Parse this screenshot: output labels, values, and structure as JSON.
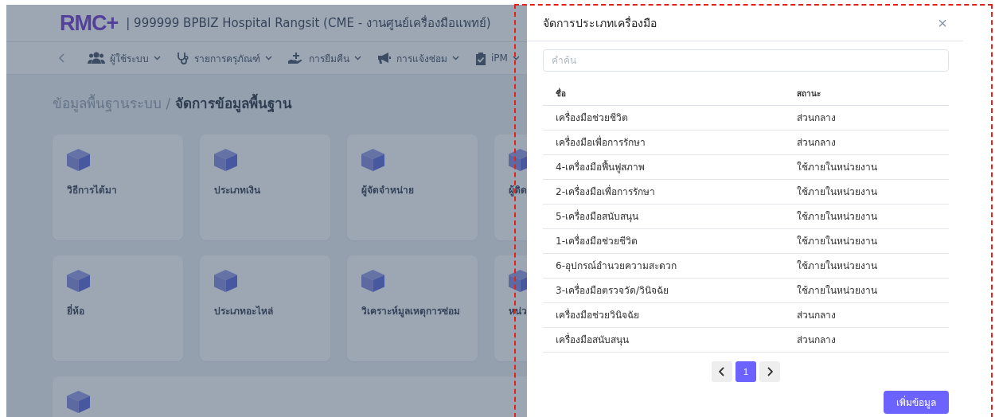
{
  "header": {
    "logo": "RMC+",
    "title": "| 999999 BPBIZ Hospital Rangsit (CME - งานศูนย์เครื่องมือแพทย์)"
  },
  "nav": [
    {
      "label": "ผู้ใช้ระบบ"
    },
    {
      "label": "รายการครุภัณฑ์"
    },
    {
      "label": "การยืมคืน"
    },
    {
      "label": "การแจ้งซ่อม"
    },
    {
      "label": "iPM"
    }
  ],
  "breadcrumb": {
    "parent": "ข้อมูลพื้นฐานระบบ /",
    "current": "จัดการข้อมูลพื้นฐาน"
  },
  "cards": [
    {
      "label": "วิธีการได้มา"
    },
    {
      "label": "ประเภทเงิน"
    },
    {
      "label": "ผู้จัดจำหน่าย"
    },
    {
      "label": "ผู้ติด"
    },
    {
      "label": "ยี่ห้อ"
    },
    {
      "label": "ประเภทอะไหล่"
    },
    {
      "label": "วิเคราะห์มูลเหตุการซ่อม"
    },
    {
      "label": "หน่ว"
    }
  ],
  "modal": {
    "title": "จัดการประเภทเครื่องมือ",
    "close": "×",
    "search": {
      "placeholder": "คำค้น"
    },
    "table": {
      "columns": [
        "ชื่อ",
        "สถานะ"
      ],
      "rows": [
        [
          "เครื่องมือช่วยชีวิต",
          "ส่วนกลาง"
        ],
        [
          "เครื่องมือเพื่อการรักษา",
          "ส่วนกลาง"
        ],
        [
          "4-เครื่องมือฟื้นฟูสภาพ",
          "ใช้ภายในหน่วยงาน"
        ],
        [
          "2-เครื่องมือเพื่อการรักษา",
          "ใช้ภายในหน่วยงาน"
        ],
        [
          "5-เครื่องมือสนับสนุน",
          "ใช้ภายในหน่วยงาน"
        ],
        [
          "1-เครื่องมือช่วยชีวิต",
          "ใช้ภายในหน่วยงาน"
        ],
        [
          "6-อุปกรณ์อำนวยความสะดวก",
          "ใช้ภายในหน่วยงาน"
        ],
        [
          "3-เครื่องมือตรวจวัด/วินิจฉัย",
          "ใช้ภายในหน่วยงาน"
        ],
        [
          "เครื่องมือช่วยวินิจฉัย",
          "ส่วนกลาง"
        ],
        [
          "เครื่องมือสนับสนุน",
          "ส่วนกลาง"
        ]
      ]
    },
    "pagination": [
      {
        "label": "1",
        "selected": true
      }
    ],
    "add_button": "เพิ่มข้อมูล"
  }
}
